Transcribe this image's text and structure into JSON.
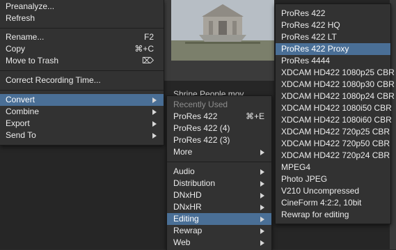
{
  "menu1": {
    "items": [
      {
        "label": "Preanalyze...",
        "shortcut": ""
      },
      {
        "label": "Refresh",
        "shortcut": ""
      },
      {
        "label": "Rename...",
        "shortcut": "F2"
      },
      {
        "label": "Copy",
        "shortcut": "⌘+C"
      },
      {
        "label": "Move to Trash",
        "shortcut": "⌦"
      },
      {
        "label": "Correct Recording Time...",
        "shortcut": ""
      },
      {
        "label": "Convert",
        "shortcut": ""
      },
      {
        "label": "Combine",
        "shortcut": ""
      },
      {
        "label": "Export",
        "shortcut": ""
      },
      {
        "label": "Send To",
        "shortcut": ""
      }
    ]
  },
  "background": {
    "clip_label": "Shrine People mov"
  },
  "menu2": {
    "header": "Recently Used",
    "items": [
      {
        "label": "ProRes 422",
        "shortcut": "⌘+E"
      },
      {
        "label": "ProRes 422 (4)",
        "shortcut": ""
      },
      {
        "label": "ProRes 422 (3)",
        "shortcut": ""
      },
      {
        "label": "More",
        "shortcut": ""
      },
      {
        "label": "Audio",
        "shortcut": ""
      },
      {
        "label": "Distribution",
        "shortcut": ""
      },
      {
        "label": "DNxHD",
        "shortcut": ""
      },
      {
        "label": "DNxHR",
        "shortcut": ""
      },
      {
        "label": "Editing",
        "shortcut": ""
      },
      {
        "label": "Rewrap",
        "shortcut": ""
      },
      {
        "label": "Web",
        "shortcut": ""
      }
    ]
  },
  "menu3": {
    "items": [
      {
        "label": "ProRes 422"
      },
      {
        "label": "ProRes 422 HQ"
      },
      {
        "label": "ProRes 422 LT"
      },
      {
        "label": "ProRes 422 Proxy"
      },
      {
        "label": "ProRes 4444"
      },
      {
        "label": "XDCAM HD422 1080p25 CBR"
      },
      {
        "label": "XDCAM HD422 1080p30 CBR"
      },
      {
        "label": "XDCAM HD422 1080p24 CBR"
      },
      {
        "label": "XDCAM HD422 1080i50 CBR"
      },
      {
        "label": "XDCAM HD422 1080i60 CBR"
      },
      {
        "label": "XDCAM HD422 720p25 CBR"
      },
      {
        "label": "XDCAM HD422 720p50 CBR"
      },
      {
        "label": "XDCAM HD422 720p24 CBR"
      },
      {
        "label": "MPEG4"
      },
      {
        "label": "Photo JPEG"
      },
      {
        "label": "V210 Uncompressed"
      },
      {
        "label": "CineForm 4:2:2, 10bit"
      },
      {
        "label": "Rewrap for editing"
      }
    ]
  },
  "colors": {
    "menu_bg": "#323232",
    "selected_bg": "#4a6f96",
    "disabled_text": "#8d8d8d"
  }
}
